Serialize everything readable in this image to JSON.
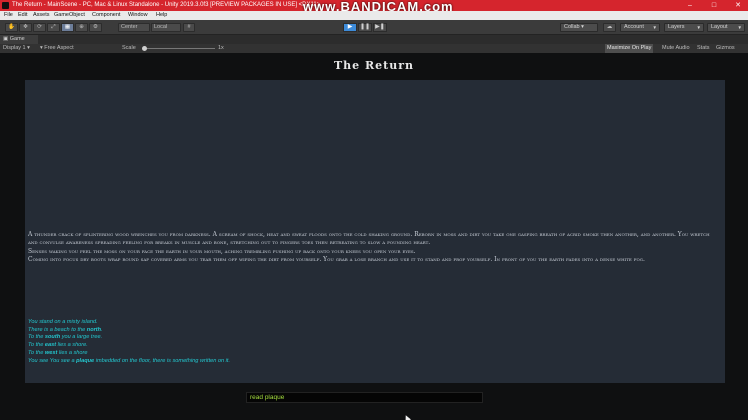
{
  "window": {
    "title": "The Return - MainScene - PC, Mac & Linux Standalone - Unity 2019.3.0f3 [PREVIEW PACKAGES IN USE] <DX11>",
    "watermark": "www.BANDICAM.com",
    "minimize": "–",
    "maximize": "□",
    "close": "✕",
    "accent": "#d5252d"
  },
  "menu": [
    "File",
    "Edit",
    "Assets",
    "GameObject",
    "Component",
    "Window",
    "Help"
  ],
  "toolbar": {
    "pivot": "Center",
    "space": "Local",
    "collab": "Collab ▾",
    "account": "Account",
    "layers": "Layers",
    "layout": "Layout",
    "play_active_color": "#3d8bd9"
  },
  "tabs": {
    "game": "Game"
  },
  "gamebar": {
    "display": "Display 1",
    "aspect": "Free Aspect",
    "scale_label": "Scale",
    "scale_value": "1x",
    "maximize_on_play": "Maximize On Play",
    "mute_audio": "Mute Audio",
    "stats": "Stats",
    "gizmos": "Gizmos"
  },
  "game": {
    "title": "The Return",
    "story": [
      "A thunder crack of splintering wood wrenches you from darkness. A scream of shock, heat and sweat floods onto the cold shaking ground. Reborn in moss and dirt you take one gasping breath of acrid smoke then another, and another. You wretch and convulse awareness spreading feeling for breaks in muscle and bone, stretching out to fingers toes then retreating to slow a pounding heart.",
      "Senses waking you feel the moss on your face the earth in your mouth, aching trembling pushing up back onto your knees you open your eyes.",
      "Coming into focus dry boots wrap round sap covered arms you tear them off wiping the dirt from yourself. You grab a lose branch and use it to stand and prop yourself. In front of you the earth fades into a dense white fog."
    ],
    "room": {
      "line1": "You stand on a misty island.",
      "north_pre": "There is a beach to the ",
      "north_dir": "north",
      "north_post": ".",
      "south_pre": "To the ",
      "south_dir": "south",
      "south_post": " you a large tree.",
      "east_pre": "To the ",
      "east_dir": "east",
      "east_post": " lies a shore.",
      "west_pre": "To the ",
      "west_dir": "west",
      "west_post": " lies a shore",
      "item_pre": "You see You see a ",
      "item": "plaque",
      "item_post": " imbedded on the floor, there is something written on it."
    },
    "room_text_color": "#23c7cf",
    "input_value": "read plaque",
    "input_text_color": "#a4dd3e"
  }
}
